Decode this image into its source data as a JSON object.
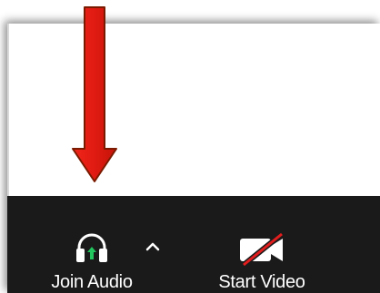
{
  "toolbar": {
    "join_audio": {
      "label": "Join Audio",
      "icon": "headphones-up-arrow-icon",
      "accent_color": "#22c55e"
    },
    "audio_options": {
      "icon": "caret-up-icon"
    },
    "start_video": {
      "label": "Start Video",
      "icon": "video-camera-off-icon",
      "strike_color": "#e11d1d"
    }
  },
  "annotation": {
    "arrow_color": "#e01b12",
    "arrow_outline_color": "#7a1a00"
  }
}
